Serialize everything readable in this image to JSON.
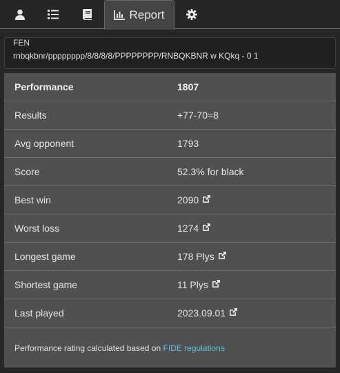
{
  "tabs": [
    {
      "icon": "user-icon",
      "label": ""
    },
    {
      "icon": "list-icon",
      "label": ""
    },
    {
      "icon": "book-icon",
      "label": ""
    },
    {
      "icon": "bar-chart-icon",
      "label": "Report",
      "active": true
    },
    {
      "icon": "gear-icon",
      "label": ""
    }
  ],
  "fen": {
    "label": "FEN",
    "value": "rnbqkbnr/pppppppp/8/8/8/8/PPPPPPPP/RNBQKBNR w KQkq - 0 1"
  },
  "report": {
    "header": {
      "label": "Performance",
      "value": "1807"
    },
    "rows": [
      {
        "label": "Results",
        "value": "+77-70=8",
        "link": false
      },
      {
        "label": "Avg opponent",
        "value": "1793",
        "link": false
      },
      {
        "label": "Score",
        "value": "52.3% for black",
        "link": false
      },
      {
        "label": "Best win",
        "value": "2090",
        "link": true
      },
      {
        "label": "Worst loss",
        "value": "1274",
        "link": true
      },
      {
        "label": "Longest game",
        "value": "178 Plys",
        "link": true
      },
      {
        "label": "Shortest game",
        "value": "11 Plys",
        "link": true
      },
      {
        "label": "Last played",
        "value": "2023.09.01",
        "link": true
      }
    ],
    "note_text": "Performance rating calculated based on",
    "note_link": "FIDE regulations"
  },
  "colors": {
    "link": "#5bc0de",
    "panel": "#505050",
    "background": "#262626"
  }
}
